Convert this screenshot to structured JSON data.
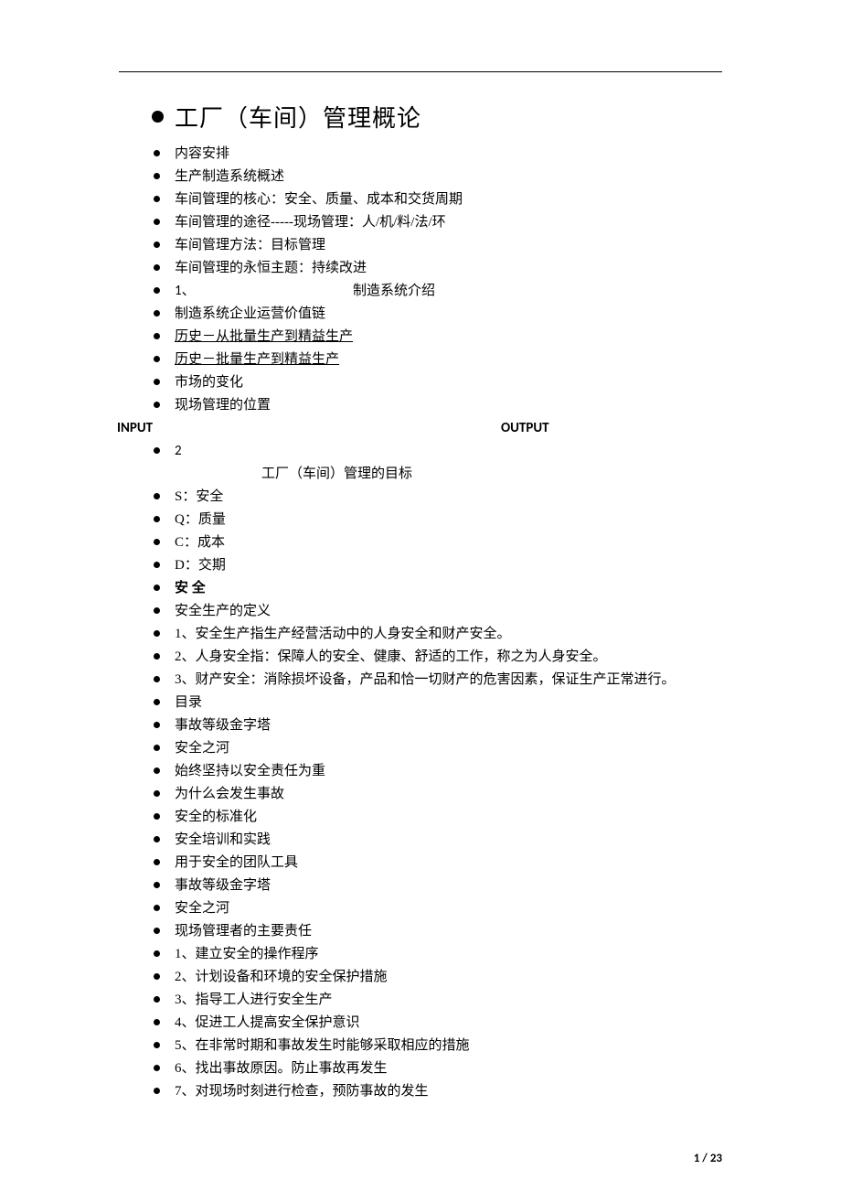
{
  "title": "工厂（车间）管理概论",
  "items1": [
    "内容安排",
    "生产制造系统概述",
    "车间管理的核心：安全、质量、成本和交货周期",
    "车间管理的途径-----现场管理：人/机/料/法/环",
    "车间管理方法：目标管理",
    "车间管理的永恒主题：持续改进"
  ],
  "section1_num": "1、",
  "section1_label": "制造系统介绍",
  "items2": [
    "制造系统企业运营价值链"
  ],
  "items2_underlined": [
    "历史－从批量生产到精益生产",
    "历史－批量生产到精益生产"
  ],
  "items3": [
    "市场的变化",
    "现场管理的位置"
  ],
  "input_label": "INPUT",
  "output_label": "OUTPUT",
  "section2_num": "2",
  "section2_sub": "工厂（车间）管理的目标",
  "items4": [
    "S：安全",
    "Q：质量",
    "C：成本",
    "D：交期"
  ],
  "bold_item": "安 全",
  "items5": [
    "安全生产的定义",
    "1、安全生产指生产经营活动中的人身安全和财产安全。",
    "2、人身安全指：保障人的安全、健康、舒适的工作，称之为人身安全。",
    "3、财产安全：消除损坏设备，产品和恰一切财产的危害因素，保证生产正常进行。",
    "目录",
    "事故等级金字塔",
    "安全之河",
    "始终坚持以安全责任为重",
    "为什么会发生事故",
    "安全的标准化",
    "安全培训和实践",
    "用于安全的团队工具",
    "事故等级金字塔",
    "安全之河",
    "现场管理者的主要责任",
    "1、建立安全的操作程序",
    "2、计划设备和环境的安全保护措施",
    "3、指导工人进行安全生产",
    "4、促进工人提高安全保护意识",
    "5、在非常时期和事故发生时能够采取相应的措施",
    "6、找出事故原因。防止事故再发生",
    "7、对现场时刻进行检查，预防事故的发生"
  ],
  "page_current": "1",
  "page_sep": " / ",
  "page_total": "23"
}
